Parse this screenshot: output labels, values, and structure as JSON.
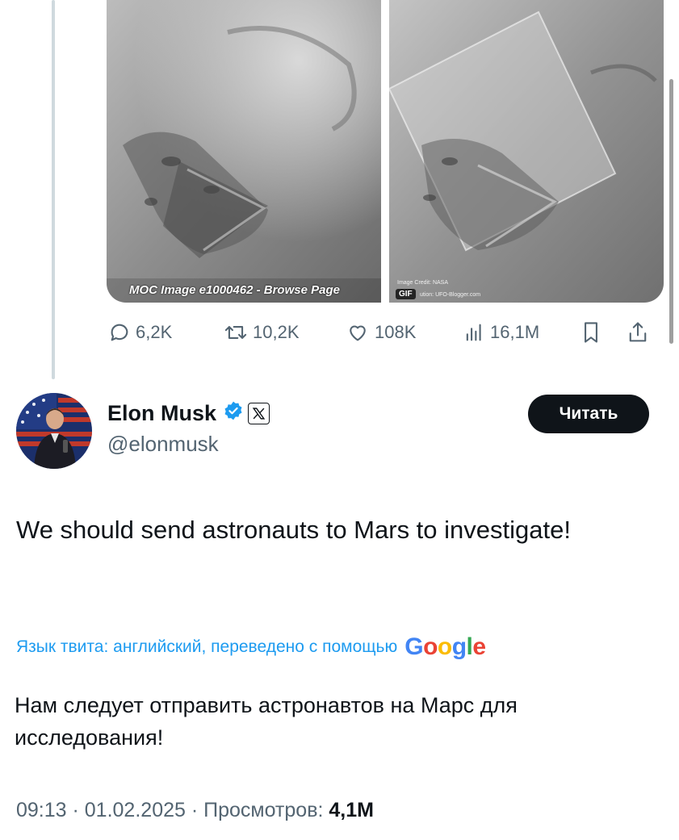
{
  "media": {
    "left_caption": "MOC Image e1000462 - Browse Page",
    "right_credit_line1": "Image Credit: NASA",
    "right_credit_line2": "ution: UFO-Blogger.com",
    "gif_badge": "GIF"
  },
  "prev_tweet_actions": {
    "replies": "6,2K",
    "reposts": "10,2K",
    "likes": "108K",
    "views": "16,1M"
  },
  "author": {
    "name": "Elon Musk",
    "handle": "@elonmusk",
    "follow_label": "Читать",
    "verified_color": "#1d9bf0"
  },
  "tweet": {
    "text": "We should send astronauts to Mars to investigate!",
    "translation_label": "Язык твита: английский, переведено с помощью",
    "translator": "Google",
    "translated_text": "Нам следует отправить астронавтов на Марс для исследования!",
    "timestamp": "09:13 · 01.02.2025 · Просмотров: ",
    "views": "4,1M"
  },
  "colors": {
    "accent": "#1d9bf0",
    "text": "#0f1419",
    "muted": "#536471",
    "button_bg": "#0f1419"
  }
}
